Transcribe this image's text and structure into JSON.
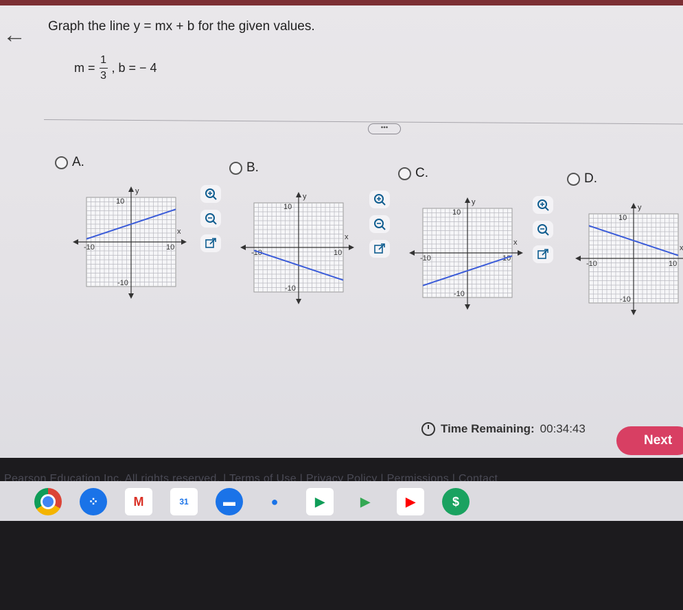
{
  "question": {
    "text": "Graph the line y = mx + b for the given values.",
    "m_label": "m =",
    "m_num": "1",
    "m_den": "3",
    "b_text": ", b = − 4"
  },
  "more_button": "•••",
  "options": [
    {
      "letter": "A.",
      "slope": 0.333,
      "intercept": 4
    },
    {
      "letter": "B.",
      "slope": -0.333,
      "intercept": -4
    },
    {
      "letter": "C.",
      "slope": 0.333,
      "intercept": -4
    },
    {
      "letter": "D.",
      "slope": -0.333,
      "intercept": 4
    }
  ],
  "graph_labels": {
    "x": "x",
    "y": "y",
    "pos": "10",
    "neg": "-10"
  },
  "timer": {
    "label": "Time Remaining:",
    "value": "00:34:43"
  },
  "next_label": "Next",
  "footer": "Pearson Education Inc. All rights reserved.  |  Terms of Use  |  Privacy Policy  |  Permissions  |  Contact",
  "colors": {
    "line": "#3a5bd9",
    "accent": "#d83f63"
  }
}
